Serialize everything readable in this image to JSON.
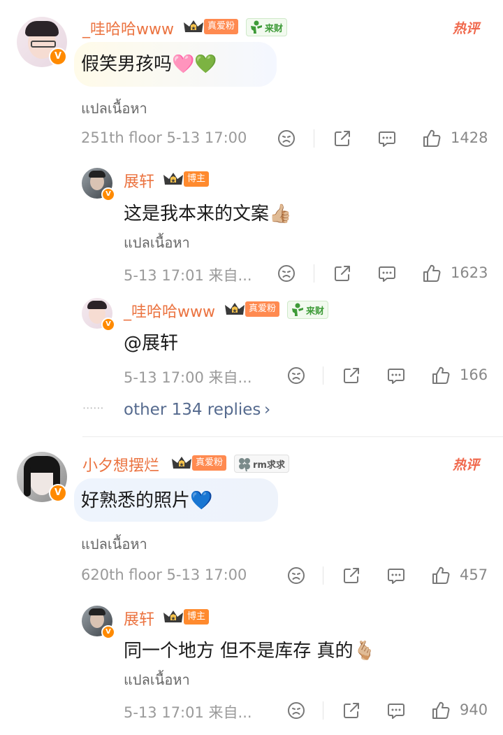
{
  "comments": [
    {
      "user": "_哇哈哈www",
      "fan_badge": "真爱粉",
      "extra_badge": "来财",
      "hot_label": "热评",
      "text": "假笑男孩吗🩷💚",
      "translate": "แปลเนื้อหา",
      "meta": "251th floor 5-13 17:00",
      "likes": "1428",
      "replies": [
        {
          "user": "展轩",
          "role_badge": "博主",
          "text": "这是我本来的文案👍🏼",
          "translate": "แปลเนื้อหา",
          "meta": "5-13 17:01 来自...",
          "likes": "1623"
        },
        {
          "user": "_哇哈哈www",
          "fan_badge": "真爱粉",
          "extra_badge": "来财",
          "text": "@展轩",
          "meta": "5-13 17:00 来自...",
          "likes": "166"
        }
      ],
      "more_replies": "other 134 replies"
    },
    {
      "user": "小夕想摆烂",
      "fan_badge": "真爱粉",
      "extra_badge": "rm求求",
      "hot_label": "热评",
      "text": "好熟悉的照片💙",
      "translate": "แปลเนื้อหา",
      "meta": "620th floor 5-13 17:00",
      "likes": "457",
      "replies": [
        {
          "user": "展轩",
          "role_badge": "博主",
          "text": "同一个地方 但不是库存 真的🫰🏼",
          "translate": "แปลเนื้อหา",
          "meta": "5-13 17:01 来自...",
          "likes": "940"
        }
      ]
    }
  ],
  "more_dots": "······",
  "verified_mark": "V",
  "colors": {
    "username": "#eb7340",
    "hot": "#f0694d",
    "link": "#556a8e"
  }
}
